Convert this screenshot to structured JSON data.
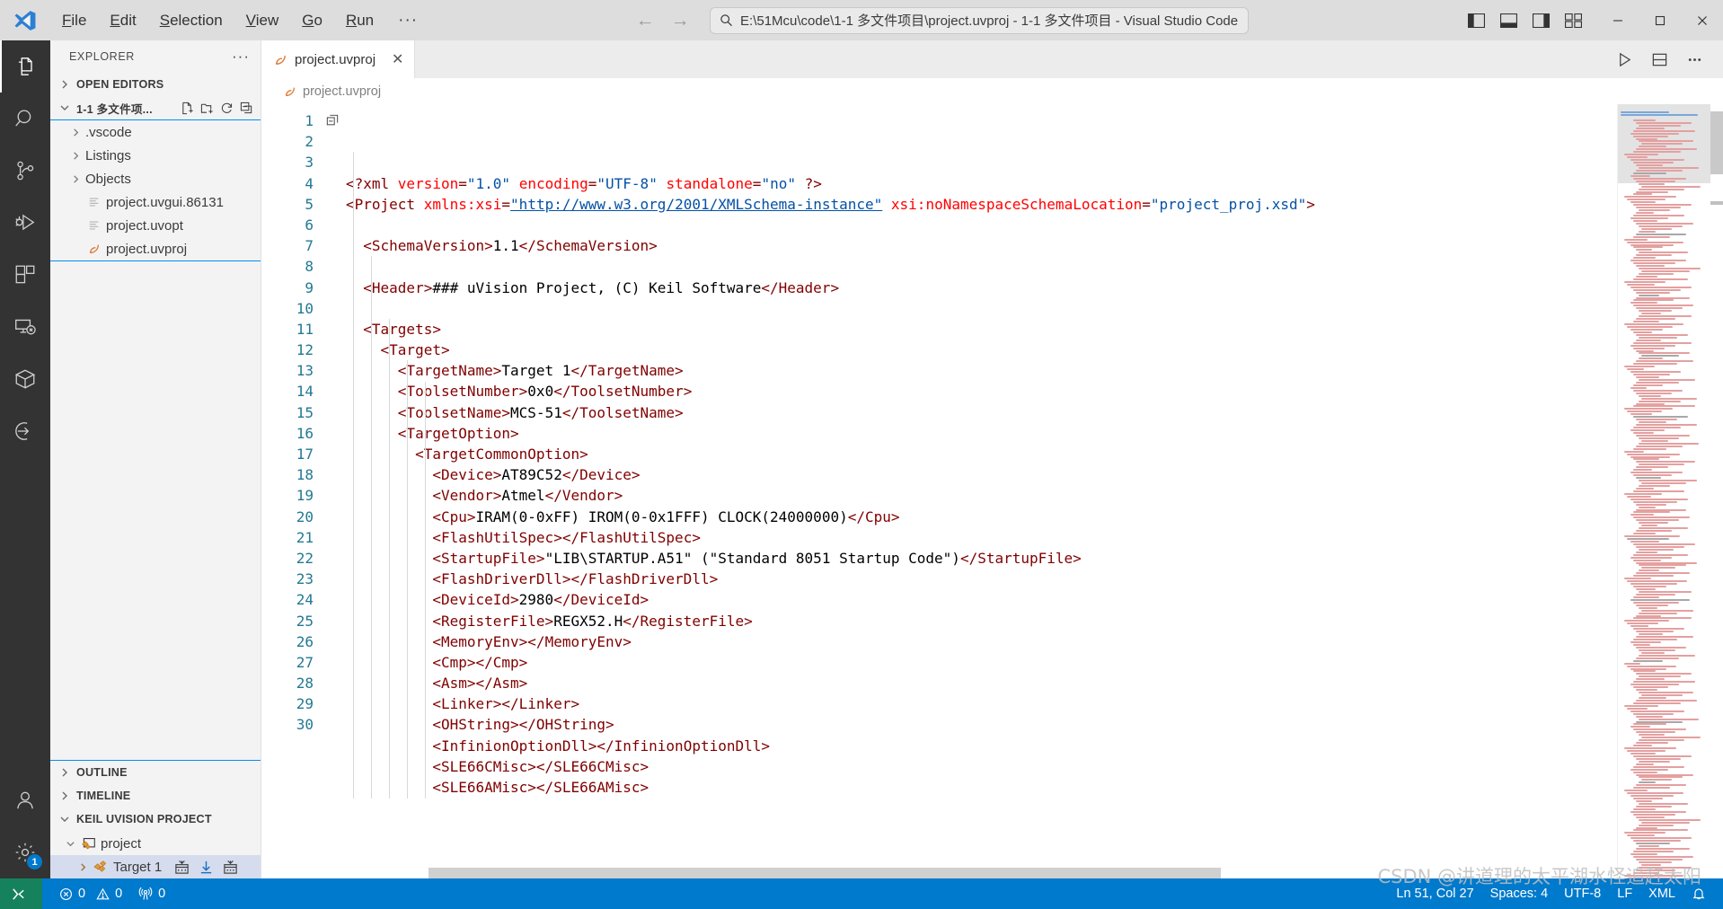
{
  "window": {
    "title": "E:\\51Mcu\\code\\1-1 多文件项目\\project.uvproj - 1-1 多文件项目 - Visual Studio Code",
    "accent_color": "#007acc",
    "remote_color": "#16825d"
  },
  "menu": {
    "items": [
      {
        "label": "File",
        "accel": "F",
        "rest": "ile"
      },
      {
        "label": "Edit",
        "accel": "E",
        "rest": "dit"
      },
      {
        "label": "Selection",
        "accel": "S",
        "rest": "election"
      },
      {
        "label": "View",
        "accel": "V",
        "rest": "iew"
      },
      {
        "label": "Go",
        "accel": "G",
        "rest": "o"
      },
      {
        "label": "Run",
        "accel": "R",
        "rest": "un"
      }
    ],
    "overflow_label": "···"
  },
  "nav": {
    "back": "←",
    "forward": "→"
  },
  "activitybar": {
    "items": [
      {
        "name": "explorer",
        "title": "Explorer",
        "active": true
      },
      {
        "name": "search",
        "title": "Search",
        "active": false
      },
      {
        "name": "source-control",
        "title": "Source Control",
        "active": false
      },
      {
        "name": "run-debug",
        "title": "Run and Debug",
        "active": false
      },
      {
        "name": "extensions",
        "title": "Extensions",
        "active": false
      },
      {
        "name": "remote-explorer",
        "title": "Remote Explorer",
        "active": false
      },
      {
        "name": "package",
        "title": "Package",
        "active": false
      },
      {
        "name": "import",
        "title": "Import",
        "active": false
      }
    ],
    "account_badge": "1"
  },
  "sidebar": {
    "title": "EXPLORER",
    "more_label": "···",
    "sections": [
      {
        "label": "OPEN EDITORS",
        "expanded": false
      },
      {
        "label": "1-1 多文件项...",
        "expanded": true
      },
      {
        "label": "OUTLINE",
        "expanded": false
      },
      {
        "label": "TIMELINE",
        "expanded": false
      },
      {
        "label": "KEIL UVISION PROJECT",
        "expanded": true
      }
    ],
    "files": [
      {
        "label": ".vscode",
        "type": "folder",
        "expanded": false
      },
      {
        "label": "Listings",
        "type": "folder",
        "expanded": false
      },
      {
        "label": "Objects",
        "type": "folder",
        "expanded": false
      },
      {
        "label": "project.uvgui.86131",
        "type": "file-generic"
      },
      {
        "label": "project.uvopt",
        "type": "file-generic"
      },
      {
        "label": "project.uvproj",
        "type": "file-xml"
      }
    ],
    "keil": {
      "project_label": "project",
      "target_label": "Target 1",
      "target_actions": [
        "build-icon",
        "download-icon",
        "rebuild-icon"
      ]
    }
  },
  "editor": {
    "tab": {
      "label": "project.uvproj",
      "icon": "xml-file-icon",
      "close": "✕"
    },
    "breadcrumb": "project.uvproj",
    "actions": [
      "run-icon",
      "split-editor-icon",
      "more-actions-icon"
    ],
    "first_line_number": 1,
    "lines": [
      {
        "n": 1,
        "tokens": [
          {
            "t": "tag",
            "v": "<?xml "
          },
          {
            "t": "attr",
            "v": "version"
          },
          {
            "t": "tag",
            "v": "="
          },
          {
            "t": "val",
            "v": "\"1.0\""
          },
          {
            "t": "tag",
            "v": " "
          },
          {
            "t": "attr",
            "v": "encoding"
          },
          {
            "t": "tag",
            "v": "="
          },
          {
            "t": "val",
            "v": "\"UTF-8\""
          },
          {
            "t": "tag",
            "v": " "
          },
          {
            "t": "attr",
            "v": "standalone"
          },
          {
            "t": "tag",
            "v": "="
          },
          {
            "t": "val",
            "v": "\"no\""
          },
          {
            "t": "tag",
            "v": " ?>"
          }
        ]
      },
      {
        "n": 2,
        "tokens": [
          {
            "t": "tag",
            "v": "<Project "
          },
          {
            "t": "attr",
            "v": "xmlns:xsi"
          },
          {
            "t": "tag",
            "v": "="
          },
          {
            "t": "link",
            "v": "\"http://www.w3.org/2001/XMLSchema-instance\""
          },
          {
            "t": "tag",
            "v": " "
          },
          {
            "t": "attr",
            "v": "xsi:noNamespaceSchemaLocation"
          },
          {
            "t": "tag",
            "v": "="
          },
          {
            "t": "val",
            "v": "\"project_proj.xsd\""
          },
          {
            "t": "tag",
            "v": ">"
          }
        ]
      },
      {
        "n": 3,
        "tokens": []
      },
      {
        "n": 4,
        "tokens": [
          {
            "t": "tag",
            "v": "  <SchemaVersion>"
          },
          {
            "t": "txt",
            "v": "1.1"
          },
          {
            "t": "tag",
            "v": "</SchemaVersion>"
          }
        ]
      },
      {
        "n": 5,
        "tokens": []
      },
      {
        "n": 6,
        "tokens": [
          {
            "t": "tag",
            "v": "  <Header>"
          },
          {
            "t": "txt",
            "v": "### uVision Project, (C) Keil Software"
          },
          {
            "t": "tag",
            "v": "</Header>"
          }
        ]
      },
      {
        "n": 7,
        "tokens": []
      },
      {
        "n": 8,
        "tokens": [
          {
            "t": "tag",
            "v": "  <Targets>"
          }
        ]
      },
      {
        "n": 9,
        "tokens": [
          {
            "t": "tag",
            "v": "    <Target>"
          }
        ]
      },
      {
        "n": 10,
        "tokens": [
          {
            "t": "tag",
            "v": "      <TargetName>"
          },
          {
            "t": "txt",
            "v": "Target 1"
          },
          {
            "t": "tag",
            "v": "</TargetName>"
          }
        ]
      },
      {
        "n": 11,
        "tokens": [
          {
            "t": "tag",
            "v": "      <ToolsetNumber>"
          },
          {
            "t": "txt",
            "v": "0x0"
          },
          {
            "t": "tag",
            "v": "</ToolsetNumber>"
          }
        ]
      },
      {
        "n": 12,
        "tokens": [
          {
            "t": "tag",
            "v": "      <ToolsetName>"
          },
          {
            "t": "txt",
            "v": "MCS-51"
          },
          {
            "t": "tag",
            "v": "</ToolsetName>"
          }
        ]
      },
      {
        "n": 13,
        "tokens": [
          {
            "t": "tag",
            "v": "      <TargetOption>"
          }
        ]
      },
      {
        "n": 14,
        "tokens": [
          {
            "t": "tag",
            "v": "        <TargetCommonOption>"
          }
        ]
      },
      {
        "n": 15,
        "tokens": [
          {
            "t": "tag",
            "v": "          <Device>"
          },
          {
            "t": "txt",
            "v": "AT89C52"
          },
          {
            "t": "tag",
            "v": "</Device>"
          }
        ]
      },
      {
        "n": 16,
        "tokens": [
          {
            "t": "tag",
            "v": "          <Vendor>"
          },
          {
            "t": "txt",
            "v": "Atmel"
          },
          {
            "t": "tag",
            "v": "</Vendor>"
          }
        ]
      },
      {
        "n": 17,
        "tokens": [
          {
            "t": "tag",
            "v": "          <Cpu>"
          },
          {
            "t": "txt",
            "v": "IRAM(0-0xFF) IROM(0-0x1FFF) CLOCK(24000000)"
          },
          {
            "t": "tag",
            "v": "</Cpu>"
          }
        ]
      },
      {
        "n": 18,
        "tokens": [
          {
            "t": "tag",
            "v": "          <FlashUtilSpec>"
          },
          {
            "t": "tag",
            "v": "</FlashUtilSpec>"
          }
        ]
      },
      {
        "n": 19,
        "tokens": [
          {
            "t": "tag",
            "v": "          <StartupFile>"
          },
          {
            "t": "txt",
            "v": "\"LIB\\STARTUP.A51\" (\"Standard 8051 Startup Code\")"
          },
          {
            "t": "tag",
            "v": "</StartupFile>"
          }
        ]
      },
      {
        "n": 20,
        "tokens": [
          {
            "t": "tag",
            "v": "          <FlashDriverDll>"
          },
          {
            "t": "tag",
            "v": "</FlashDriverDll>"
          }
        ]
      },
      {
        "n": 21,
        "tokens": [
          {
            "t": "tag",
            "v": "          <DeviceId>"
          },
          {
            "t": "txt",
            "v": "2980"
          },
          {
            "t": "tag",
            "v": "</DeviceId>"
          }
        ]
      },
      {
        "n": 22,
        "tokens": [
          {
            "t": "tag",
            "v": "          <RegisterFile>"
          },
          {
            "t": "txt",
            "v": "REGX52.H"
          },
          {
            "t": "tag",
            "v": "</RegisterFile>"
          }
        ]
      },
      {
        "n": 23,
        "tokens": [
          {
            "t": "tag",
            "v": "          <MemoryEnv>"
          },
          {
            "t": "tag",
            "v": "</MemoryEnv>"
          }
        ]
      },
      {
        "n": 24,
        "tokens": [
          {
            "t": "tag",
            "v": "          <Cmp>"
          },
          {
            "t": "tag",
            "v": "</Cmp>"
          }
        ]
      },
      {
        "n": 25,
        "tokens": [
          {
            "t": "tag",
            "v": "          <Asm>"
          },
          {
            "t": "tag",
            "v": "</Asm>"
          }
        ]
      },
      {
        "n": 26,
        "tokens": [
          {
            "t": "tag",
            "v": "          <Linker>"
          },
          {
            "t": "tag",
            "v": "</Linker>"
          }
        ]
      },
      {
        "n": 27,
        "tokens": [
          {
            "t": "tag",
            "v": "          <OHString>"
          },
          {
            "t": "tag",
            "v": "</OHString>"
          }
        ]
      },
      {
        "n": 28,
        "tokens": [
          {
            "t": "tag",
            "v": "          <InfinionOptionDll>"
          },
          {
            "t": "tag",
            "v": "</InfinionOptionDll>"
          }
        ]
      },
      {
        "n": 29,
        "tokens": [
          {
            "t": "tag",
            "v": "          <SLE66CMisc>"
          },
          {
            "t": "tag",
            "v": "</SLE66CMisc>"
          }
        ]
      },
      {
        "n": 30,
        "tokens": [
          {
            "t": "tag",
            "v": "          <SLE66AMisc>"
          },
          {
            "t": "tag",
            "v": "</SLE66AMisc>"
          }
        ]
      }
    ]
  },
  "statusbar": {
    "remote_label": "",
    "errors": "0",
    "warnings": "0",
    "ports": "0",
    "position": "Ln 51, Col 27",
    "indentation": "Spaces: 4",
    "encoding": "UTF-8",
    "eol": "LF",
    "language": "XML",
    "bell": "🔔"
  },
  "watermark": "CSDN @讲道理的太平湖水怪追赶太阳"
}
